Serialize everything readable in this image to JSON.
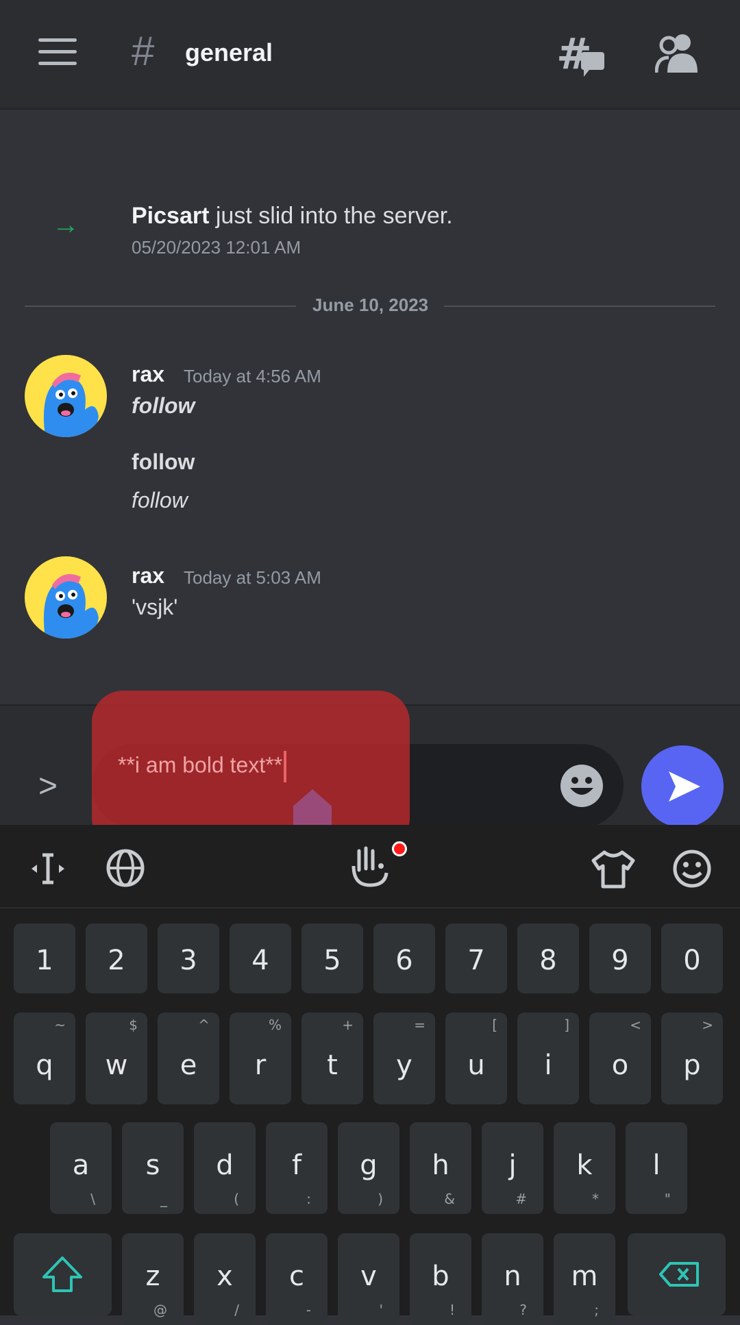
{
  "header": {
    "hash": "#",
    "channel": "general"
  },
  "messages": {
    "join": {
      "user": "Picsart",
      "text": " just slid into the server.",
      "time": "05/20/2023 12:01 AM"
    },
    "date_divider": "June 10, 2023",
    "groups": [
      {
        "username": "rax",
        "time": "Today at 4:56 AM",
        "lines": [
          "follow",
          "follow",
          "follow"
        ]
      },
      {
        "username": "rax",
        "time": "Today at 5:03 AM",
        "lines": [
          "'vsjk'"
        ]
      }
    ]
  },
  "composer": {
    "value": "**i am bold text**",
    "expand": ">"
  },
  "keyboard": {
    "numbers": [
      "1",
      "2",
      "3",
      "4",
      "5",
      "6",
      "7",
      "8",
      "9",
      "0"
    ],
    "row1": [
      {
        "k": "q",
        "s": "~"
      },
      {
        "k": "w",
        "s": "$"
      },
      {
        "k": "e",
        "s": "^"
      },
      {
        "k": "r",
        "s": "%"
      },
      {
        "k": "t",
        "s": "+"
      },
      {
        "k": "y",
        "s": "="
      },
      {
        "k": "u",
        "s": "["
      },
      {
        "k": "i",
        "s": "]"
      },
      {
        "k": "o",
        "s": "<"
      },
      {
        "k": "p",
        "s": ">"
      }
    ],
    "row2": [
      {
        "k": "a",
        "s": "\\"
      },
      {
        "k": "s",
        "s": "_"
      },
      {
        "k": "d",
        "s": "("
      },
      {
        "k": "f",
        "s": ":"
      },
      {
        "k": "g",
        "s": ")"
      },
      {
        "k": "h",
        "s": "&"
      },
      {
        "k": "j",
        "s": "#"
      },
      {
        "k": "k",
        "s": "*"
      },
      {
        "k": "l",
        "s": "\""
      }
    ],
    "row3": [
      {
        "k": "z",
        "s": "@"
      },
      {
        "k": "x",
        "s": "/"
      },
      {
        "k": "c",
        "s": "-"
      },
      {
        "k": "v",
        "s": "'"
      },
      {
        "k": "b",
        "s": "!"
      },
      {
        "k": "n",
        "s": "?"
      },
      {
        "k": "m",
        "s": ";"
      }
    ]
  },
  "colors": {
    "accent": "#5865f2",
    "join_arrow": "#23a55a",
    "selection_highlight": "#b9282c"
  }
}
